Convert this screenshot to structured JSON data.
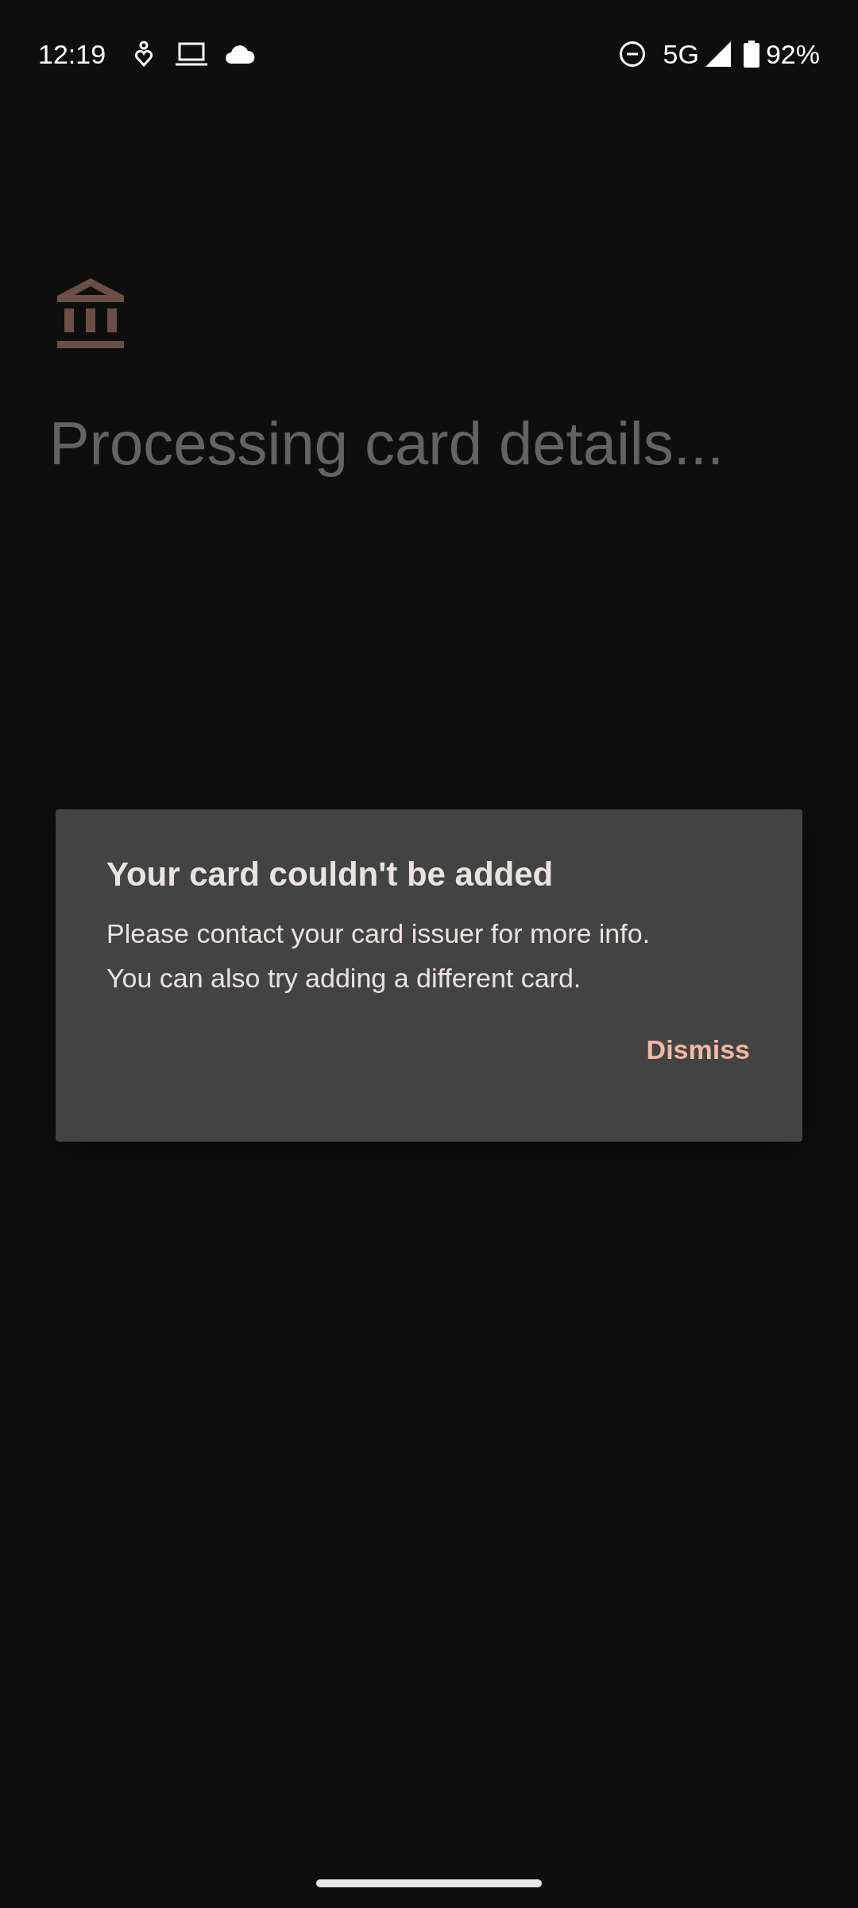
{
  "status_bar": {
    "time": "12:19",
    "network": "5G",
    "battery": "92%"
  },
  "screen": {
    "title": "Processing card details..."
  },
  "dialog": {
    "title": "Your card couldn't be added",
    "body": [
      "Please contact your card issuer for more info.",
      "You can also try adding a different card."
    ],
    "buttons": [
      "Dismiss"
    ]
  }
}
